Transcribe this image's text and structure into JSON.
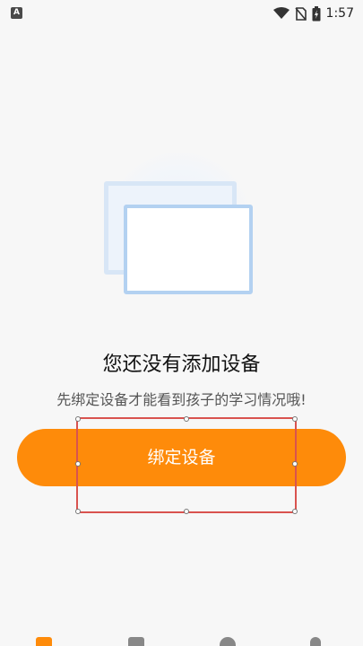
{
  "status_bar": {
    "app_icon_letter": "A",
    "time": "1:57",
    "icons": [
      "wifi-icon",
      "no-sim-icon",
      "battery-charging-icon"
    ]
  },
  "empty_state": {
    "title": "您还没有添加设备",
    "subtitle": "先绑定设备才能看到孩子的学习情况哦!",
    "bind_button_label": "绑定设备"
  },
  "colors": {
    "accent": "#fe8b0a",
    "selection": "#d9534f",
    "illustration_border": "#b3d1f1"
  },
  "bottom_nav": {
    "icons": [
      "home-icon",
      "mail-icon",
      "discover-icon",
      "profile-icon"
    ]
  }
}
